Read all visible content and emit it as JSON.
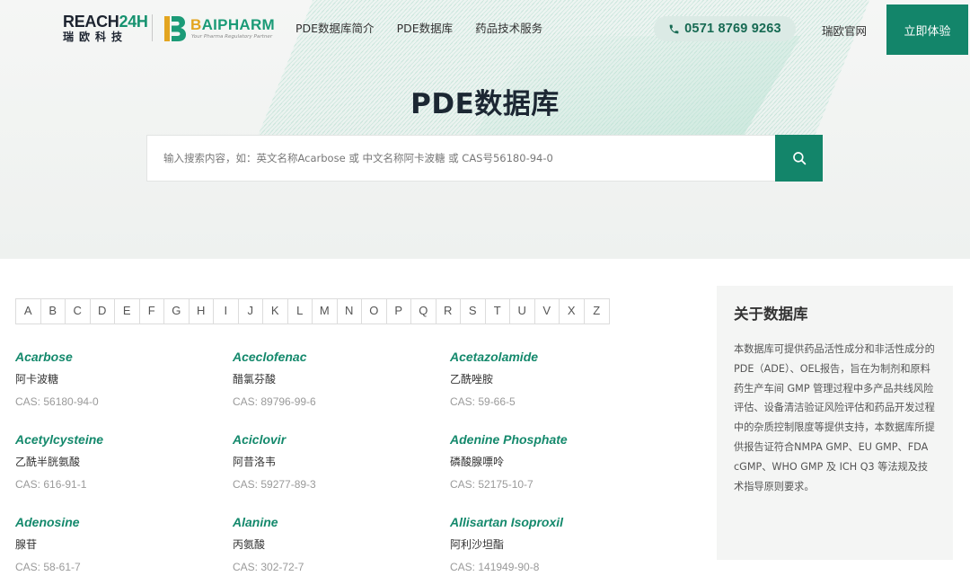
{
  "header": {
    "reach_logo": {
      "line1a": "REACH",
      "line1b": "24H",
      "line2": "瑞欧科技"
    },
    "bai_logo": {
      "name_b": "B",
      "name_rest": "AIPHARM",
      "tagline": "Your Pharma Regulatory Partner"
    },
    "nav": [
      "PDE数据库简介",
      "PDE数据库",
      "药品技术服务"
    ],
    "phone": "0571 8769 9263",
    "site_link": "瑞欧官网",
    "cta": "立即体验"
  },
  "hero": {
    "title": "PDE数据库",
    "search_placeholder": "输入搜索内容，如：英文名称Acarbose 或 中文名称阿卡波糖 或 CAS号56180-94-0"
  },
  "alphabet": [
    "A",
    "B",
    "C",
    "D",
    "E",
    "F",
    "G",
    "H",
    "I",
    "J",
    "K",
    "L",
    "M",
    "N",
    "O",
    "P",
    "Q",
    "R",
    "S",
    "T",
    "U",
    "V",
    "X",
    "Z"
  ],
  "drugs": [
    {
      "en": "Acarbose",
      "cn": "阿卡波糖",
      "cas": "CAS: 56180-94-0"
    },
    {
      "en": "Aceclofenac",
      "cn": "醋氯芬酸",
      "cas": "CAS: 89796-99-6"
    },
    {
      "en": "Acetazolamide",
      "cn": "乙酰唑胺",
      "cas": "CAS: 59-66-5"
    },
    {
      "en": "Acetylcysteine",
      "cn": "乙酰半胱氨酸",
      "cas": "CAS: 616-91-1"
    },
    {
      "en": "Aciclovir",
      "cn": "阿昔洛韦",
      "cas": "CAS: 59277-89-3"
    },
    {
      "en": "Adenine Phosphate",
      "cn": "磷酸腺嘌呤",
      "cas": "CAS: 52175-10-7"
    },
    {
      "en": "Adenosine",
      "cn": "腺苷",
      "cas": "CAS: 58-61-7"
    },
    {
      "en": "Alanine",
      "cn": "丙氨酸",
      "cas": "CAS: 302-72-7"
    },
    {
      "en": "Allisartan Isoproxil",
      "cn": "阿利沙坦酯",
      "cas": "CAS: 141949-90-8"
    }
  ],
  "about": {
    "title": "关于数据库",
    "text": "本数据库可提供药品活性成分和非活性成分的PDE（ADE）、OEL报告，旨在为制剂和原料药生产车间 GMP 管理过程中多产品共线风险评估、设备清洁验证风险评估和药品开发过程中的杂质控制限度等提供支持，本数据库所提供报告证符合NMPA GMP、EU GMP、FDA cGMP、WHO GMP 及 ICH Q3 等法规及技术指导原则要求。"
  },
  "colors": {
    "brand": "#13856a",
    "link": "#14896c",
    "phone_bg": "#dbeae5"
  },
  "icons": [
    "phone-icon",
    "search-icon",
    "bai-logo-mark"
  ]
}
